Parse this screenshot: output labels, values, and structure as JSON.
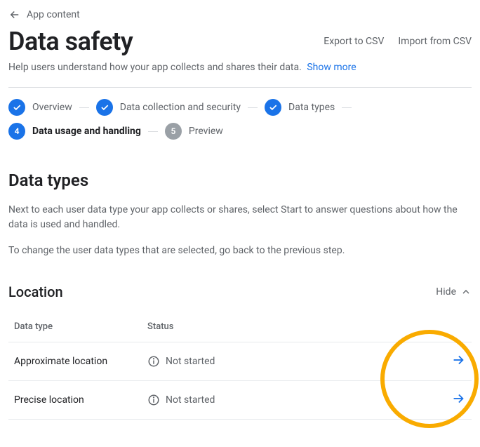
{
  "breadcrumb": {
    "label": "App content"
  },
  "header": {
    "title": "Data safety",
    "actions": {
      "export": "Export to CSV",
      "import": "Import from CSV"
    },
    "subtitle": "Help users understand how your app collects and shares their data.",
    "show_more": "Show more"
  },
  "stepper": {
    "items": [
      {
        "label": "Overview",
        "state": "done",
        "badge": "check"
      },
      {
        "label": "Data collection and security",
        "state": "done",
        "badge": "check"
      },
      {
        "label": "Data types",
        "state": "done",
        "badge": "check"
      },
      {
        "label": "Data usage and handling",
        "state": "current",
        "badge": "4"
      },
      {
        "label": "Preview",
        "state": "pending",
        "badge": "5"
      }
    ]
  },
  "section": {
    "heading": "Data types",
    "para1": "Next to each user data type your app collects or shares, select Start to answer questions about how the data is used and handled.",
    "para2": "To change the user data types that are selected, go back to the previous step."
  },
  "group": {
    "title": "Location",
    "toggle": "Hide",
    "columns": {
      "type": "Data type",
      "status": "Status"
    },
    "rows": [
      {
        "type": "Approximate location",
        "status": "Not started"
      },
      {
        "type": "Precise location",
        "status": "Not started"
      }
    ]
  },
  "colors": {
    "accent": "#1a73e8",
    "highlight": "#f9ab00"
  }
}
